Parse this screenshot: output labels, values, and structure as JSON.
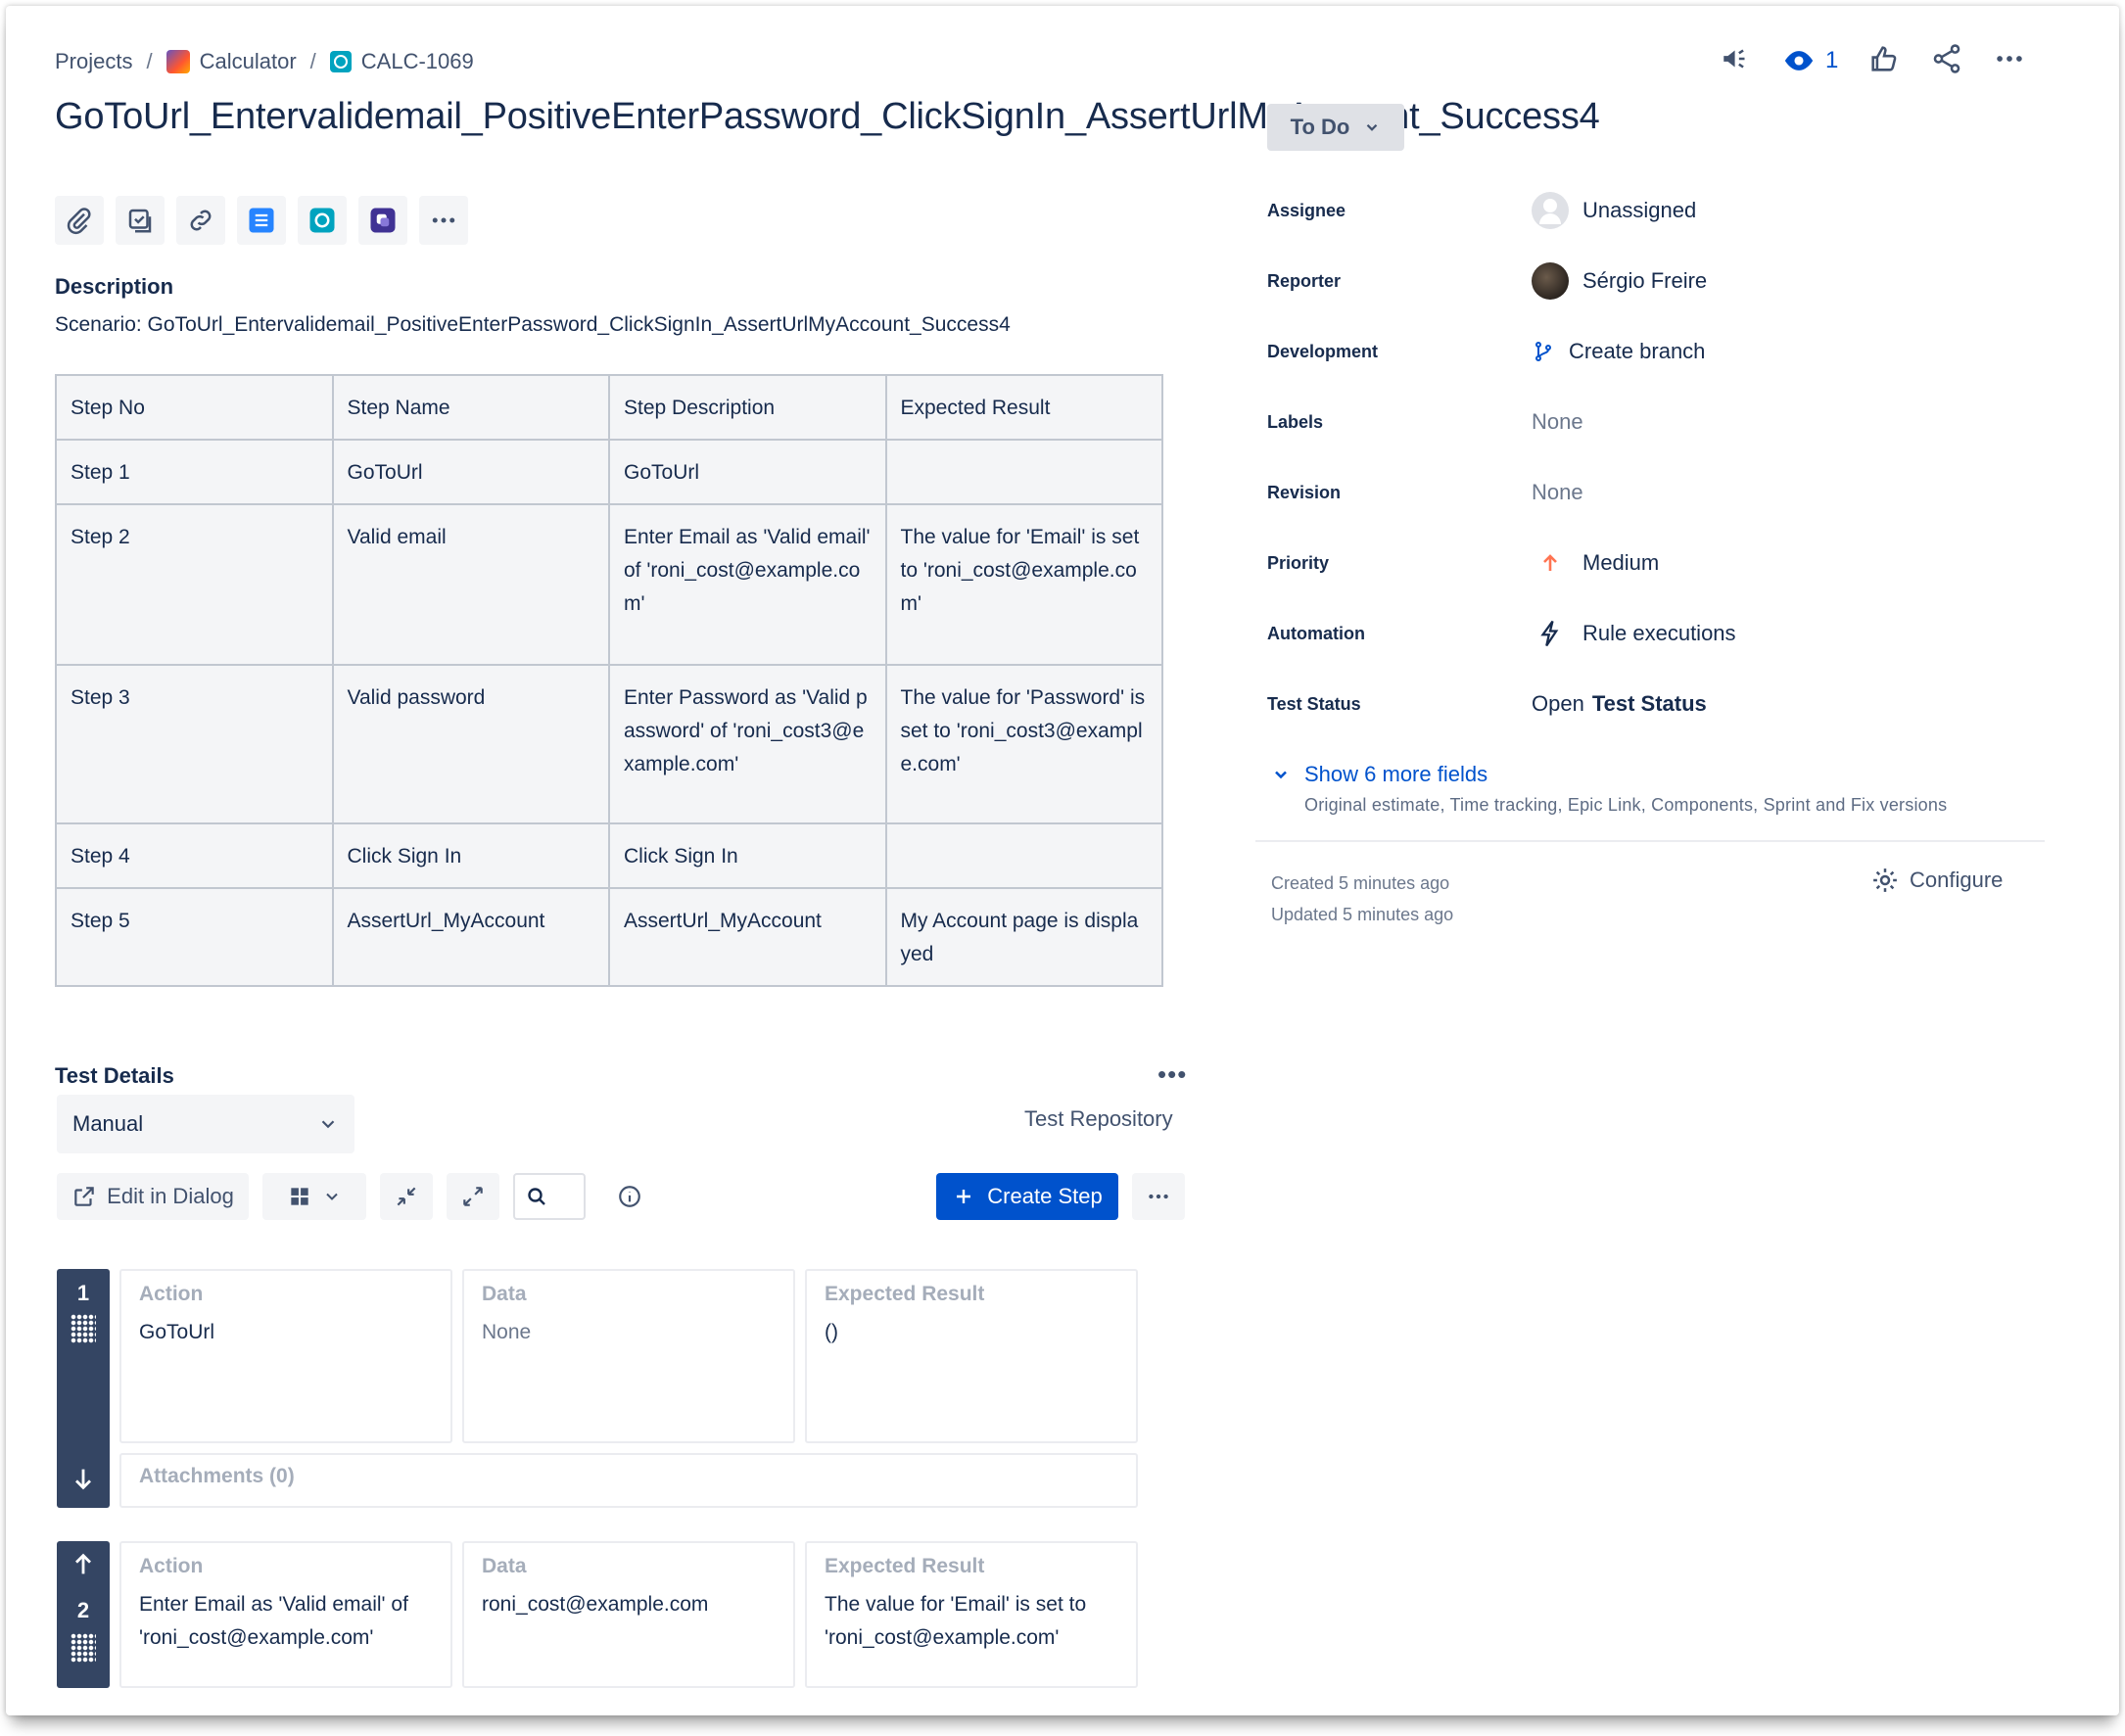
{
  "breadcrumb": {
    "projects": "Projects",
    "project": "Calculator",
    "issue_key": "CALC-1069",
    "sep": "/"
  },
  "top_actions": {
    "watch_count": "1"
  },
  "title": "GoToUrl_Entervalidemail_PositiveEnterPassword_ClickSignIn_AssertUrlMyAccount_Success4",
  "description": {
    "label": "Description",
    "text": "Scenario: GoToUrl_Entervalidemail_PositiveEnterPassword_ClickSignIn_AssertUrlMyAccount_Success4"
  },
  "steps_table": {
    "headers": [
      "Step No",
      "Step Name",
      "Step Description",
      "Expected Result"
    ],
    "rows": [
      [
        "Step 1",
        "GoToUrl",
        "GoToUrl",
        ""
      ],
      [
        "Step 2",
        "Valid email",
        "Enter Email as 'Valid email' of 'roni_cost@example.com'",
        "The value for 'Email' is set to 'roni_cost@example.com'"
      ],
      [
        "Step 3",
        "Valid password",
        "Enter Password as 'Valid password' of 'roni_cost3@example.com'",
        "The value for 'Password' is set to 'roni_cost3@example.com'"
      ],
      [
        "Step 4",
        "Click Sign In",
        "Click Sign In",
        ""
      ],
      [
        "Step 5",
        "AssertUrl_MyAccount",
        "AssertUrl_MyAccount",
        "My Account page is displayed"
      ]
    ]
  },
  "test_details": {
    "label": "Test Details",
    "more": "•••",
    "type": "Manual",
    "repository": "Test Repository",
    "edit_dialog": "Edit in Dialog",
    "create_step": "Create Step",
    "steps": [
      {
        "num": "1",
        "action_h": "Action",
        "action": "GoToUrl",
        "data_h": "Data",
        "data": "None",
        "expected_h": "Expected Result",
        "expected": "()",
        "attachments": "Attachments (0)"
      },
      {
        "num": "2",
        "action_h": "Action",
        "action": "Enter Email as 'Valid email' of 'roni_cost@example.com'",
        "data_h": "Data",
        "data": "roni_cost@example.com",
        "expected_h": "Expected Result",
        "expected": "The value for 'Email' is set to 'roni_cost@example.com'"
      }
    ]
  },
  "sidebar": {
    "status": "To Do",
    "fields": [
      {
        "label": "Assignee",
        "value": "Unassigned"
      },
      {
        "label": "Reporter",
        "value": "Sérgio Freire"
      },
      {
        "label": "Development",
        "value": "Create branch"
      },
      {
        "label": "Labels",
        "value": "None"
      },
      {
        "label": "Revision",
        "value": "None"
      },
      {
        "label": "Priority",
        "value": "Medium"
      },
      {
        "label": "Automation",
        "value": "Rule executions"
      },
      {
        "label": "Test Status",
        "value_prefix": "Open",
        "value": "Test Status"
      }
    ],
    "show_more": "Show 6 more fields",
    "show_more_sub": "Original estimate, Time tracking, Epic Link, Components, Sprint and Fix versions",
    "created": "Created 5 minutes ago",
    "updated": "Updated 5 minutes ago",
    "configure": "Configure"
  },
  "colors": {
    "brand": "#0052cc",
    "rail": "#344563",
    "priority_medium": "#ff7452"
  }
}
